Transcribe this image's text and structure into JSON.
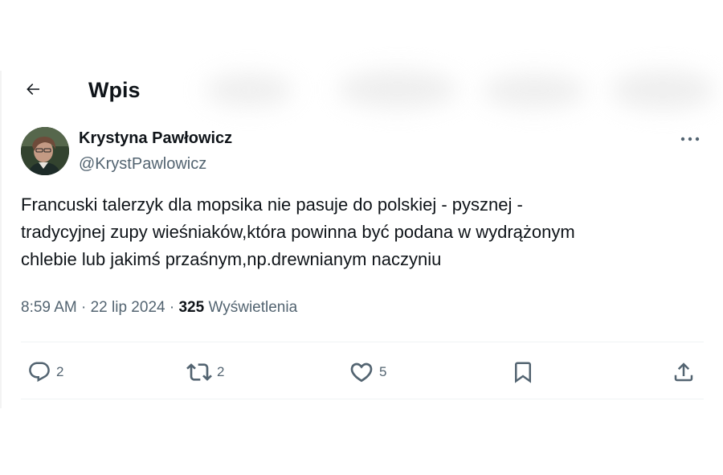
{
  "header": {
    "title": "Wpis",
    "back_icon": "arrow-left-icon"
  },
  "tweet": {
    "author_name": "Krystyna Pawłowicz",
    "author_handle": "@KrystPawlowicz",
    "text_lines": [
      "Francuski talerzyk dla mopsika nie pasuje do polskiej - pysznej -",
      "tradycyjnej zupy wieśniaków,która powinna być podana w wydrążonym",
      "chlebie lub jakimś przaśnym,np.drewnianym naczyniu"
    ],
    "time": "8:59 AM",
    "date": "22 lip 2024",
    "views_count": "325",
    "views_label": "Wyświetlenia",
    "separator": "·"
  },
  "actions": {
    "reply_count": "2",
    "retweet_count": "2",
    "like_count": "5"
  },
  "colors": {
    "text_primary": "#0f1419",
    "text_secondary": "#536471",
    "divider": "#eff3f4"
  }
}
